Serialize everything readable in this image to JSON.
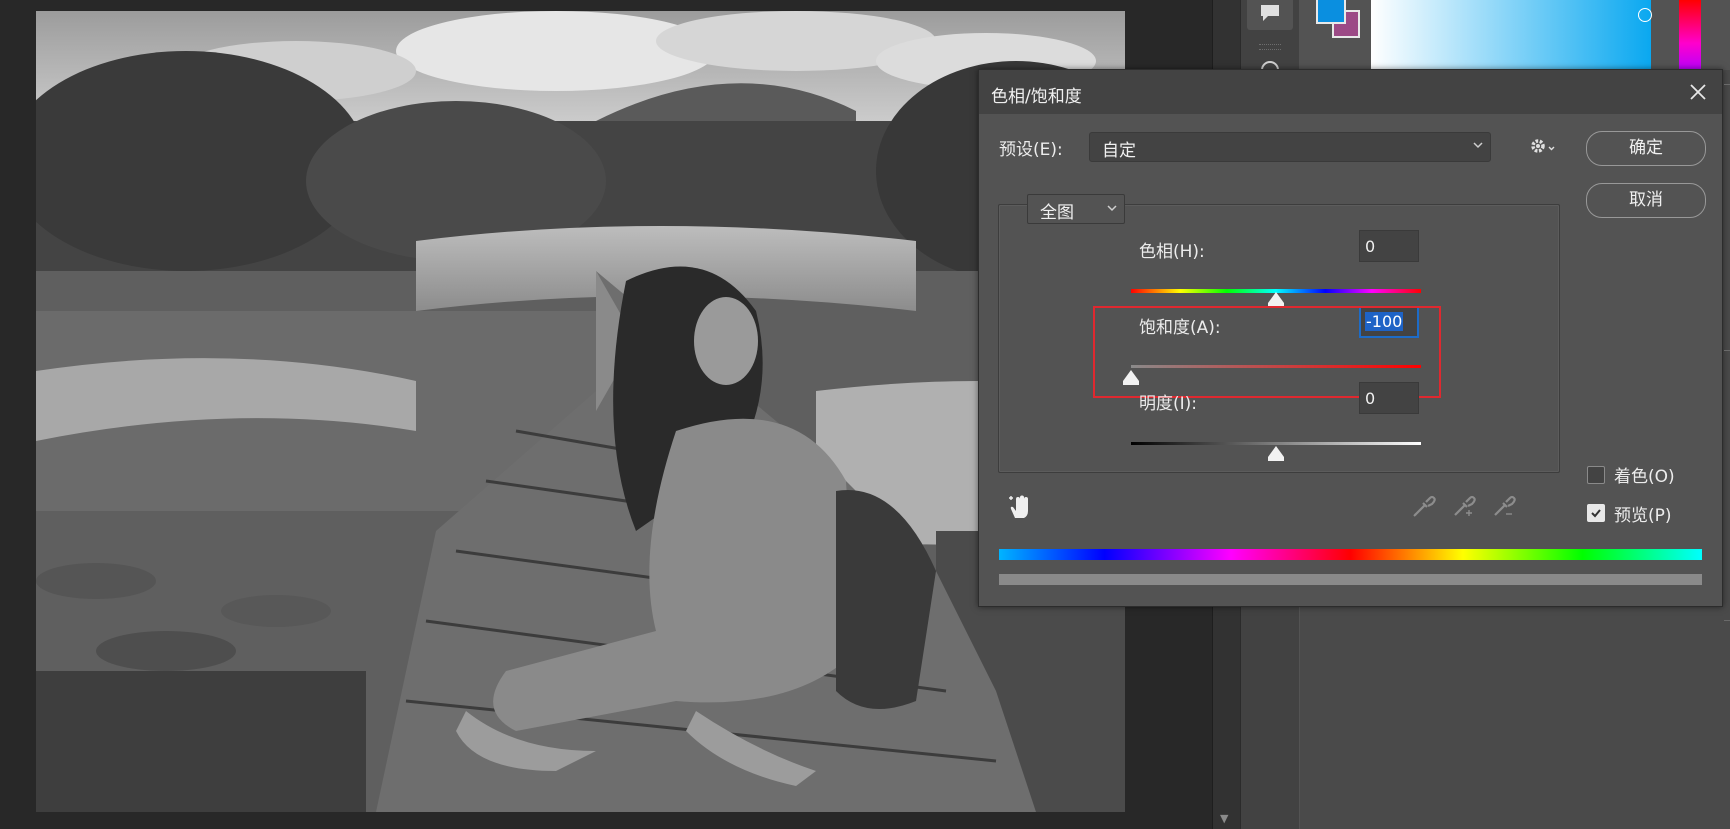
{
  "dialog": {
    "title": "色相/饱和度",
    "preset_label": "预设(E):",
    "preset_value": "自定",
    "ok_label": "确定",
    "cancel_label": "取消",
    "channel_value": "全图",
    "hue": {
      "label": "色相(H):",
      "value": "0",
      "slider_level": 0.5
    },
    "saturation": {
      "label": "饱和度(A):",
      "value": "-100",
      "slider_level": 0.0
    },
    "lightness": {
      "label": "明度(I):",
      "value": "0",
      "slider_level": 0.5
    },
    "colorize": {
      "label": "着色(O)",
      "checked": false
    },
    "preview": {
      "label": "预览(P)",
      "checked": true
    }
  },
  "colors": {
    "foreground": "#0a8fe0",
    "background": "#9c4a86",
    "highlight_box": "#e0282f",
    "selection": "#1e63c6"
  },
  "icons": {
    "close": "close-icon",
    "gear": "gear-icon",
    "hand": "targeted-adjustment-hand-icon",
    "eyedropper": "eyedropper-icon",
    "eyedropper_plus": "eyedropper-plus-icon",
    "eyedropper_minus": "eyedropper-minus-icon",
    "comment": "comment-icon",
    "info": "info-icon"
  }
}
